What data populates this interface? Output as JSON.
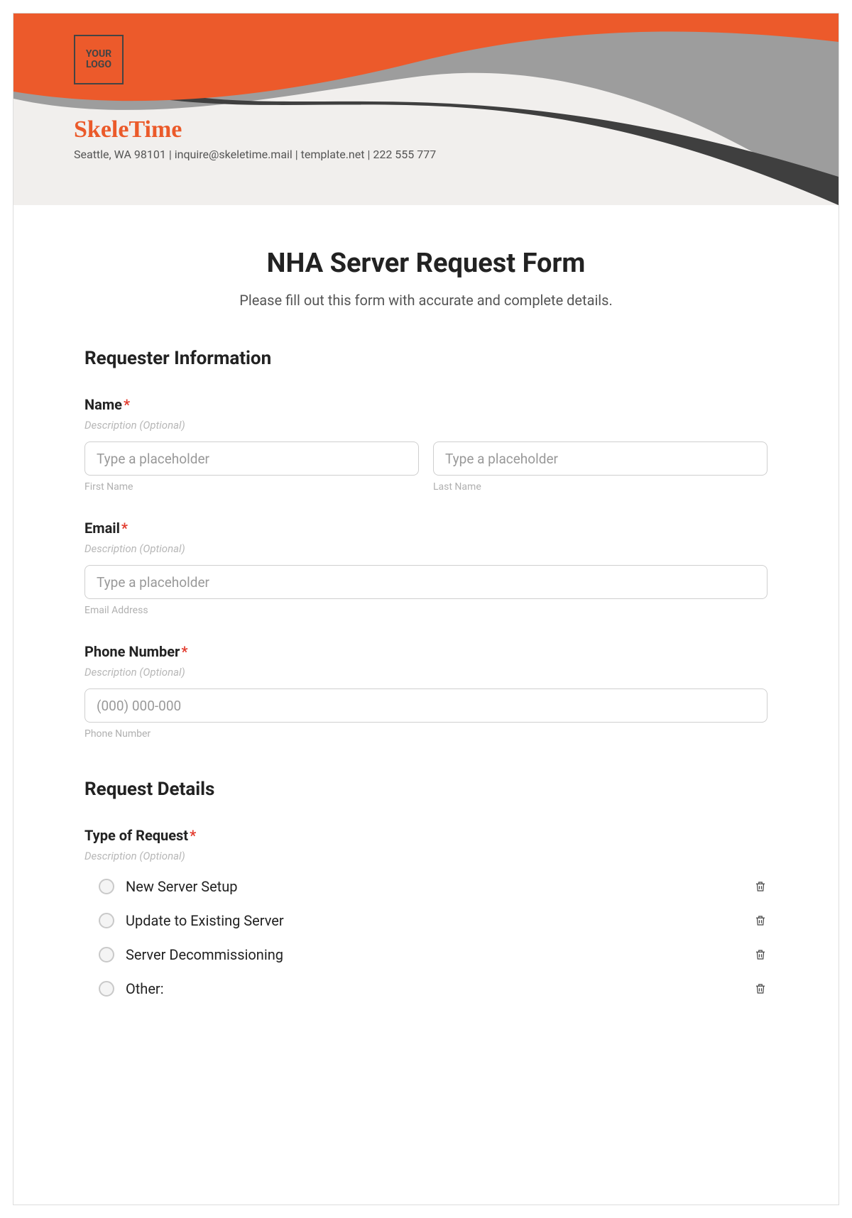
{
  "header": {
    "logo_text": "YOUR LOGO",
    "brand": "SkeleTime",
    "contact": "Seattle, WA 98101 | inquire@skeletime.mail | template.net | 222 555 777"
  },
  "form": {
    "title": "NHA Server Request Form",
    "subtitle": "Please fill out this form with accurate and complete details.",
    "sections": {
      "requester": {
        "heading": "Requester Information",
        "name": {
          "label": "Name",
          "desc": "Description (Optional)",
          "first_placeholder": "Type a placeholder",
          "first_sub": "First Name",
          "last_placeholder": "Type a placeholder",
          "last_sub": "Last Name"
        },
        "email": {
          "label": "Email",
          "desc": "Description (Optional)",
          "placeholder": "Type a placeholder",
          "sub": "Email Address"
        },
        "phone": {
          "label": "Phone Number",
          "desc": "Description (Optional)",
          "placeholder": "(000) 000-000",
          "sub": "Phone Number"
        }
      },
      "details": {
        "heading": "Request Details",
        "type": {
          "label": "Type of Request",
          "desc": "Description (Optional)",
          "options": [
            "New Server Setup",
            "Update to Existing Server",
            "Server Decommissioning",
            "Other:"
          ]
        }
      }
    }
  },
  "required_marker": "*"
}
